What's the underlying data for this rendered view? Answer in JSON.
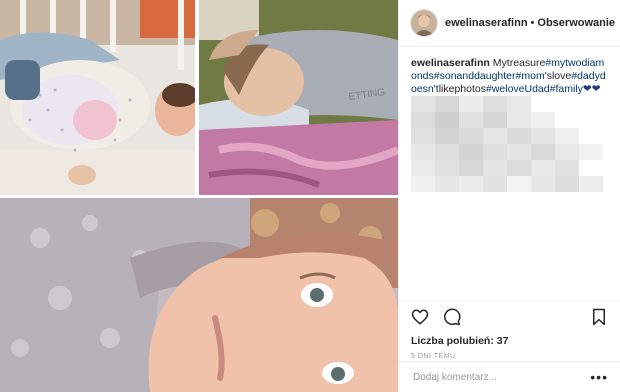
{
  "post": {
    "username": "ewelinaserafinn",
    "separator": "•",
    "follow_label": "Obserwowanie",
    "caption": {
      "author": "ewelinaserafinn",
      "segments": [
        {
          "text": "Mytreasure",
          "type": "plain"
        },
        {
          "text": "#mytwodiamonds",
          "type": "tag"
        },
        {
          "text": "#sonanddaughter",
          "type": "tag"
        },
        {
          "text": "#mom",
          "type": "tag"
        },
        {
          "text": "'slove",
          "type": "plain"
        },
        {
          "text": "#dadydoesn",
          "type": "tag"
        },
        {
          "text": "'tlikephotos",
          "type": "plain"
        },
        {
          "text": "#weloveUdad",
          "type": "tag"
        },
        {
          "text": "#family",
          "type": "tag"
        },
        {
          "text": "❤❤❤",
          "type": "hearts"
        }
      ]
    },
    "likes_text": "Liczba polubień: 37",
    "time_text": "5 DNI TEMU",
    "comment_placeholder": "Dodaj komentarz...",
    "more_label": "•••"
  },
  "icons": {
    "like": "heart-outline-icon",
    "comment": "comment-bubble-icon",
    "save": "bookmark-icon",
    "more": "more-options-icon"
  },
  "colors": {
    "hashtag": "#003569",
    "text": "#262626",
    "muted": "#999999",
    "border": "#efefef"
  }
}
